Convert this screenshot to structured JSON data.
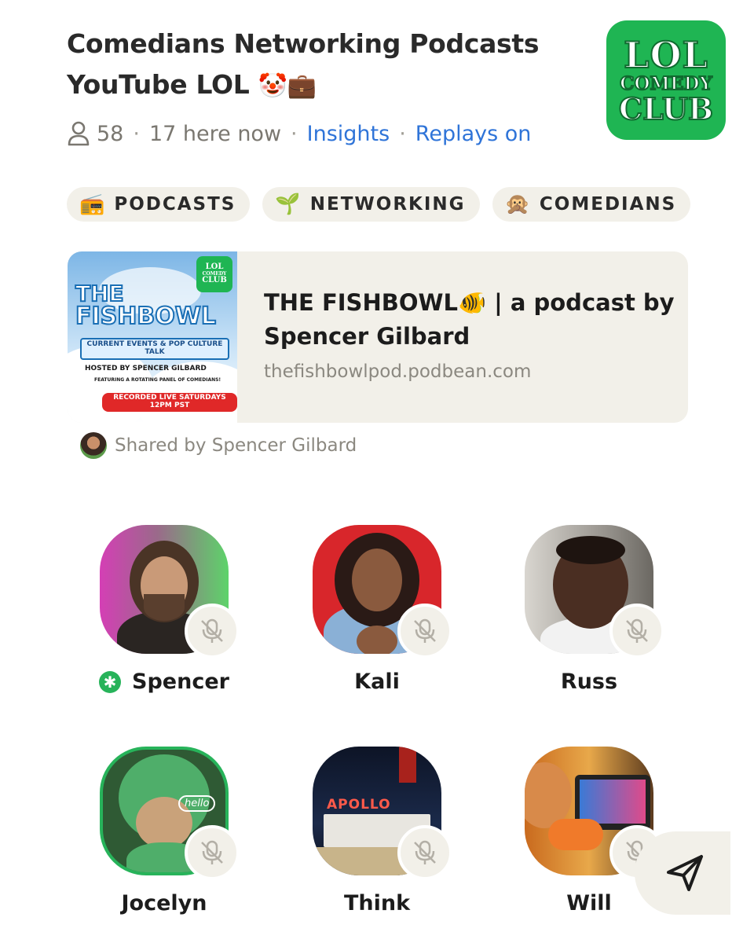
{
  "room": {
    "title_line1": "Comedians Networking Podcasts",
    "title_line2": "YouTube LOL",
    "title_emojis": "🤡💼",
    "member_count": "58",
    "here_now": "17 here now",
    "insights_label": "Insights",
    "replays_label": "Replays on",
    "icons": {
      "members": "person-icon"
    }
  },
  "club_logo": {
    "line1": "LOL",
    "line2": "COMEDY",
    "line3": "CLUB"
  },
  "topics": [
    {
      "icon": "📻",
      "label": "PODCASTS"
    },
    {
      "icon": "🌱",
      "label": "NETWORKING"
    },
    {
      "icon": "🙊",
      "label": "COMEDIANS"
    }
  ],
  "link_card": {
    "title": "THE FISHBOWL🐠 | a podcast by Spencer Gilbard",
    "url": "thefishbowlpod.podbean.com",
    "thumbnail": {
      "logo_l1": "LOL",
      "logo_l2": "COMEDY",
      "logo_l3": "CLUB",
      "title_a": "THE",
      "title_b": "FISHBOWL",
      "subtitle": "CURRENT EVENTS & POP CULTURE TALK",
      "host": "HOSTED BY SPENCER GILBARD",
      "featuring": "FEATURING A ROTATING PANEL OF COMEDIANS!",
      "recorded": "RECORDED LIVE SATURDAYS 12PM PST"
    }
  },
  "shared_by": "Shared by Spencer Gilbard",
  "speakers": [
    {
      "name": "Spencer",
      "moderator": true,
      "muted": true
    },
    {
      "name": "Kali",
      "moderator": false,
      "muted": true
    },
    {
      "name": "Russ",
      "moderator": false,
      "muted": true
    },
    {
      "name": "Jocelyn",
      "moderator": false,
      "muted": true
    },
    {
      "name": "Think",
      "moderator": false,
      "muted": true
    },
    {
      "name": "Will",
      "moderator": false,
      "muted": true
    }
  ],
  "moderator_badge": "✱",
  "colors": {
    "accent_link": "#2f74d8",
    "club_green": "#1fb553",
    "chip_bg": "#f2f0e9"
  }
}
